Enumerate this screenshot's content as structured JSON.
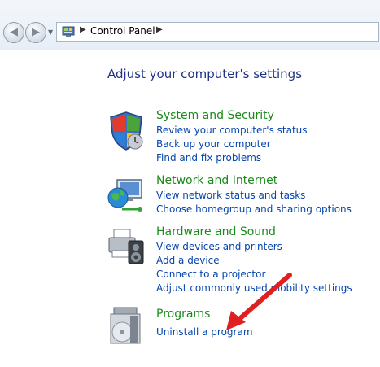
{
  "breadcrumb": {
    "label": "Control Panel"
  },
  "page_title": "Adjust your computer's settings",
  "categories": [
    {
      "title": "System and Security",
      "icon": "shield-icon",
      "links": [
        "Review your computer's status",
        "Back up your computer",
        "Find and fix problems"
      ]
    },
    {
      "title": "Network and Internet",
      "icon": "network-globe-icon",
      "links": [
        "View network status and tasks",
        "Choose homegroup and sharing options"
      ]
    },
    {
      "title": "Hardware and Sound",
      "icon": "printer-speaker-icon",
      "links": [
        "View devices and printers",
        "Add a device",
        "Connect to a projector",
        "Adjust commonly used mobility settings"
      ]
    },
    {
      "title": "Programs",
      "icon": "programs-disc-icon",
      "links": [
        "Uninstall a program"
      ]
    }
  ],
  "colors": {
    "title": "#1e3287",
    "category": "#1a8a1a",
    "link": "#0645ad",
    "arrow": "#e02020"
  }
}
